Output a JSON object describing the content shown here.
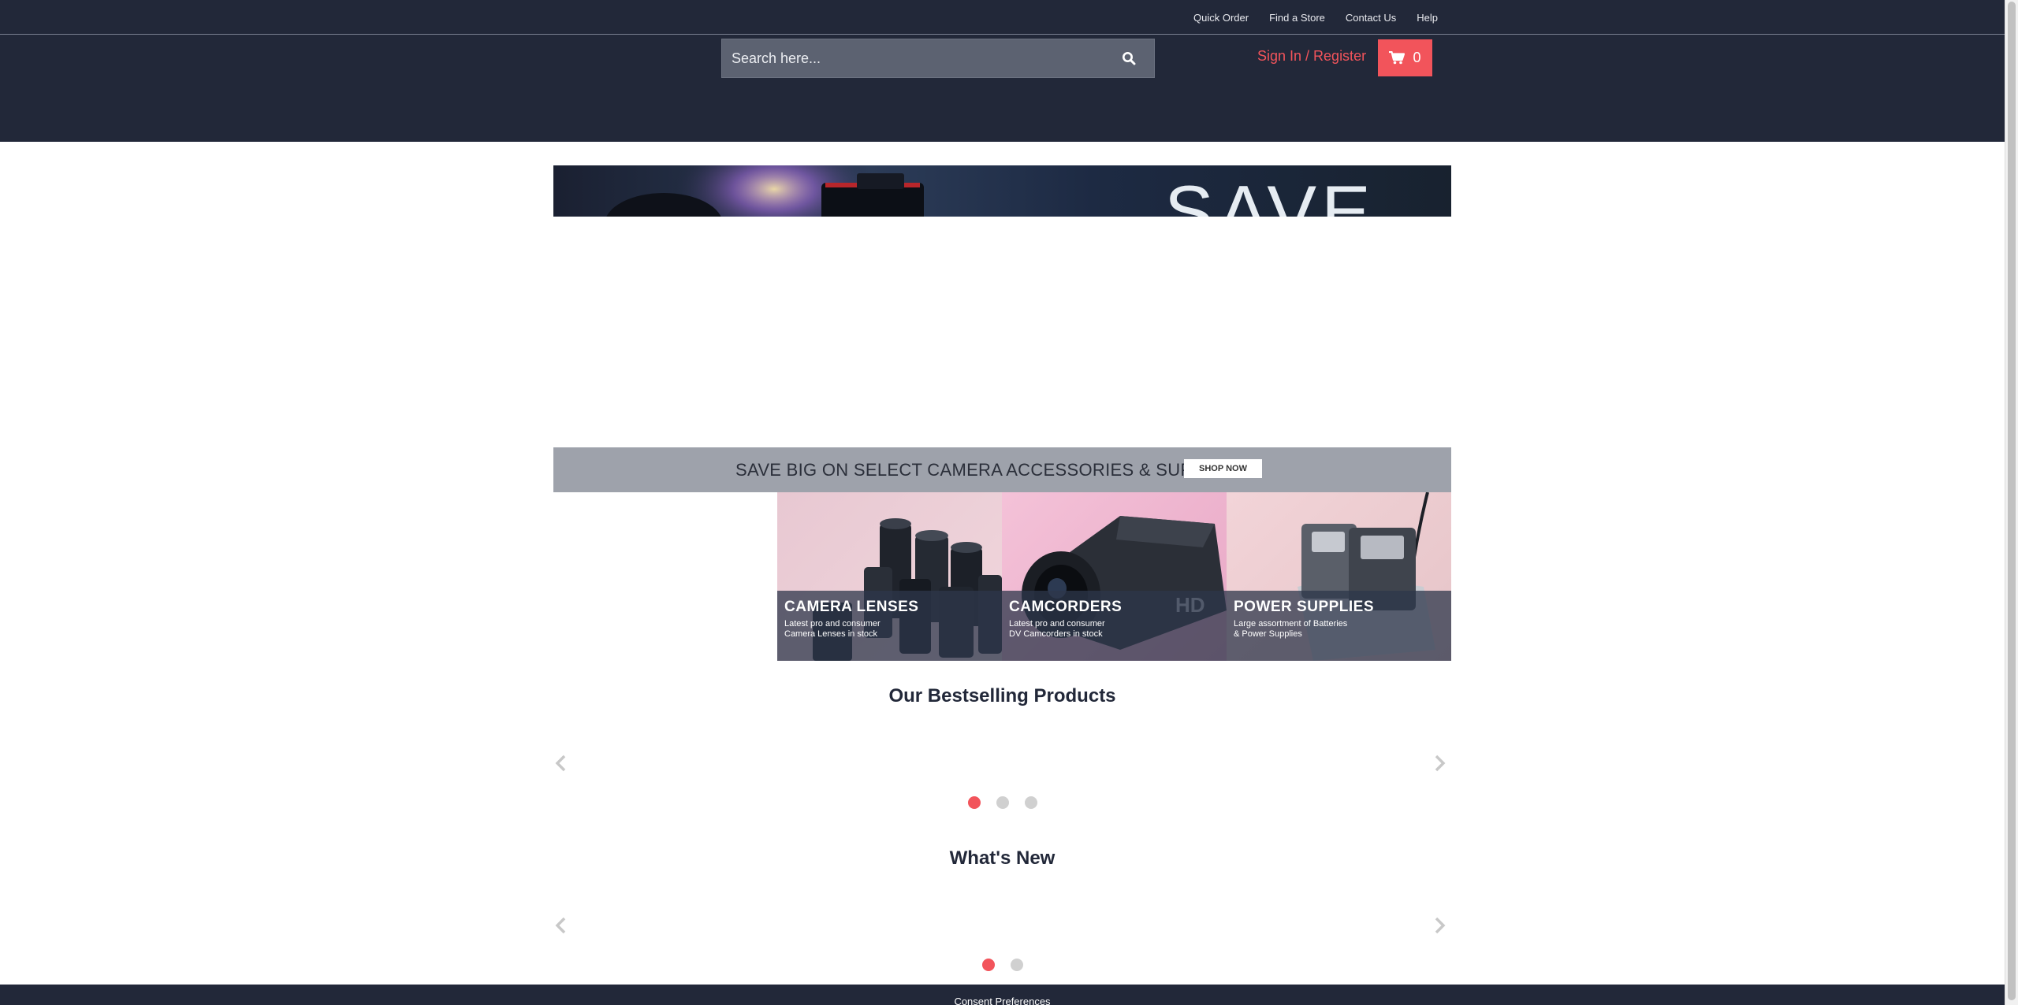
{
  "topbar": {
    "links": [
      "Quick Order",
      "Find a Store",
      "Contact Us",
      "Help"
    ]
  },
  "header": {
    "search_placeholder": "Search here...",
    "signin_label": "Sign In / Register",
    "cart_count": "0"
  },
  "hero": {
    "partial_text": "SAVE"
  },
  "promo": {
    "text": "SAVE BIG ON SELECT CAMERA ACCESSORIES & SUPPLIES",
    "button_label": "SHOP NOW"
  },
  "categories": [
    {
      "title": "CAMERA LENSES",
      "subtitle": "Latest pro and consumer\nCamera Lenses in stock"
    },
    {
      "title": "CAMCORDERS",
      "subtitle": "Latest pro and consumer\nDV Camcorders in stock"
    },
    {
      "title": "POWER SUPPLIES",
      "subtitle": "Large assortment of Batteries\n& Power Supplies"
    }
  ],
  "bestsellers": {
    "title": "Our Bestselling Products",
    "active_page": 1,
    "pages": 3
  },
  "whats_new": {
    "title": "What's New",
    "active_page": 1,
    "pages": 2
  },
  "footer": {
    "consent_label": "Consent Preferences"
  },
  "colors": {
    "navy": "#222839",
    "accent": "#f2545b",
    "promo_bg": "#9ea2ab"
  }
}
